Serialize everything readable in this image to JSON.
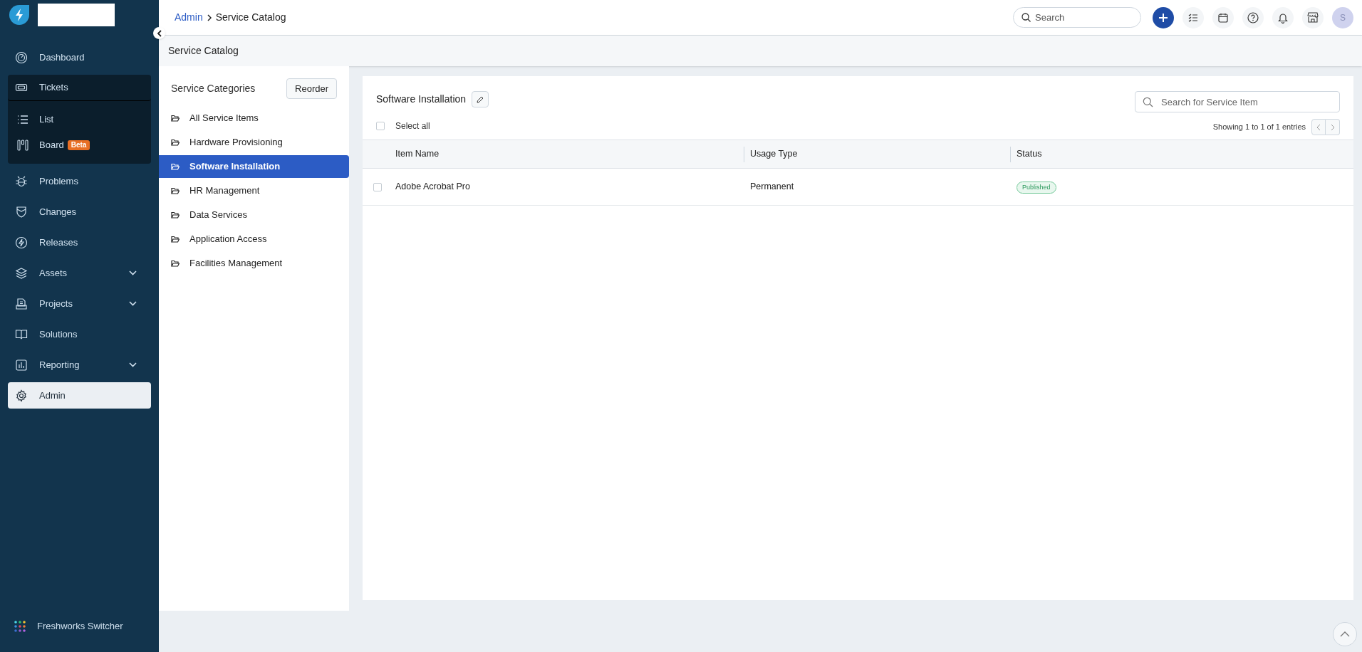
{
  "sidebar": {
    "items": [
      {
        "kind": "link",
        "label": "Dashboard",
        "selected": false,
        "expandable": false
      },
      {
        "kind": "group",
        "label": "Tickets",
        "selected": false,
        "expanded": true,
        "children": [
          {
            "label": "List"
          },
          {
            "label": "Board",
            "badge": "Beta"
          }
        ]
      },
      {
        "kind": "link",
        "label": "Problems",
        "selected": false,
        "expandable": false
      },
      {
        "kind": "link",
        "label": "Changes",
        "selected": false,
        "expandable": false
      },
      {
        "kind": "link",
        "label": "Releases",
        "selected": false,
        "expandable": false
      },
      {
        "kind": "link",
        "label": "Assets",
        "selected": false,
        "expandable": true
      },
      {
        "kind": "link",
        "label": "Projects",
        "selected": false,
        "expandable": true
      },
      {
        "kind": "link",
        "label": "Solutions",
        "selected": false,
        "expandable": false
      },
      {
        "kind": "link",
        "label": "Reporting",
        "selected": false,
        "expandable": true
      },
      {
        "kind": "link",
        "label": "Admin",
        "selected": true,
        "expandable": false
      }
    ],
    "footer": "Freshworks Switcher"
  },
  "top_bar": {
    "breadcrumb": [
      "Admin",
      "Service Catalog"
    ],
    "search": {
      "placeholder": "Search"
    },
    "avatar": "S"
  },
  "page_title": "Service Catalog",
  "categories": {
    "title": "Service Categories",
    "reorder_button": "Reorder",
    "items": [
      {
        "label": "All Service Items",
        "selected": false
      },
      {
        "label": "Hardware Provisioning",
        "selected": false
      },
      {
        "label": "Software Installation",
        "selected": true
      },
      {
        "label": "HR Management",
        "selected": false
      },
      {
        "label": "Data Services",
        "selected": false
      },
      {
        "label": "Application Access",
        "selected": false
      },
      {
        "label": "Facilities Management",
        "selected": false
      }
    ]
  },
  "items_panel": {
    "title": "Software Installation",
    "search": {
      "placeholder": "Search for Service Item"
    },
    "select_all": {
      "label": "Select all",
      "checked": false
    },
    "pagination": "Showing 1 to 1 of 1 entries",
    "table": {
      "columns": [
        "Item Name",
        "Usage Type",
        "Status"
      ],
      "rows": [
        {
          "checked": false,
          "cells": [
            "Adobe Acrobat Pro",
            "Permanent"
          ],
          "status": "Published"
        }
      ]
    }
  }
}
